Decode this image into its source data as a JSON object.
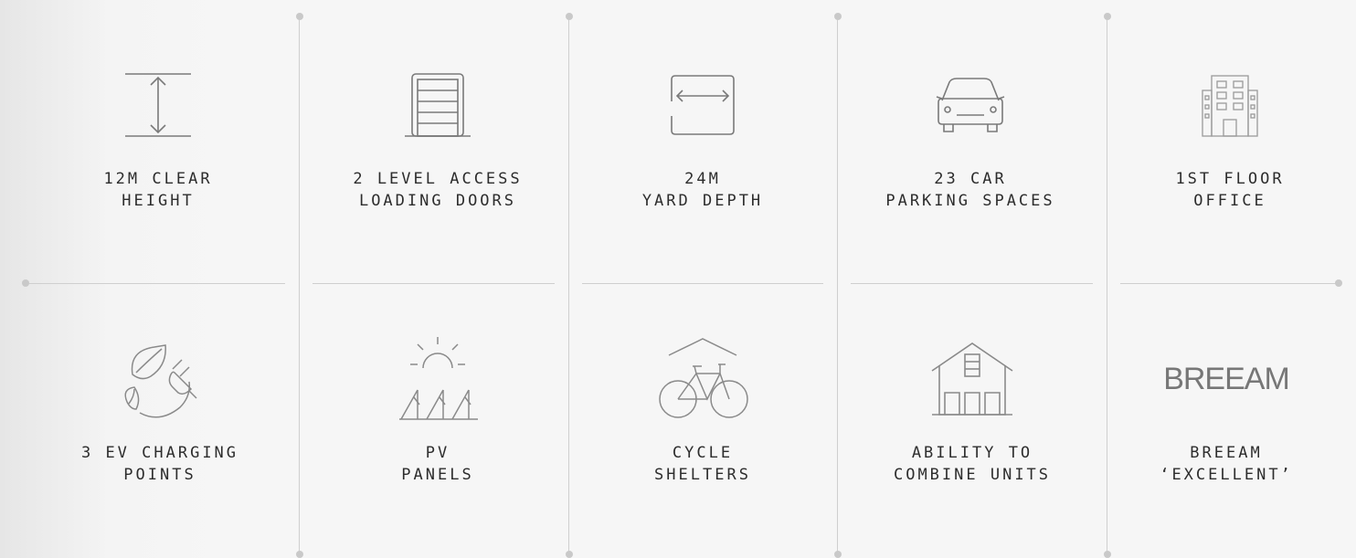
{
  "features": [
    {
      "icon": "height-arrow-icon",
      "label": "12M CLEAR\nHEIGHT"
    },
    {
      "icon": "loading-door-icon",
      "label": "2 LEVEL ACCESS\nLOADING DOORS"
    },
    {
      "icon": "yard-depth-icon",
      "label": "24M\nYARD DEPTH"
    },
    {
      "icon": "car-icon",
      "label": "23 CAR\nPARKING SPACES"
    },
    {
      "icon": "office-building-icon",
      "label": "1ST FLOOR\nOFFICE"
    },
    {
      "icon": "ev-charging-icon",
      "label": "3 EV CHARGING\nPOINTS"
    },
    {
      "icon": "solar-panel-icon",
      "label": "PV\nPANELS"
    },
    {
      "icon": "bicycle-shelter-icon",
      "label": "CYCLE\nSHELTERS"
    },
    {
      "icon": "warehouse-units-icon",
      "label": "ABILITY TO\nCOMBINE UNITS"
    },
    {
      "icon": "breeam-logo-icon",
      "label": "BREEAM\n‘EXCELLENT’",
      "mark": "BREEAM"
    }
  ]
}
